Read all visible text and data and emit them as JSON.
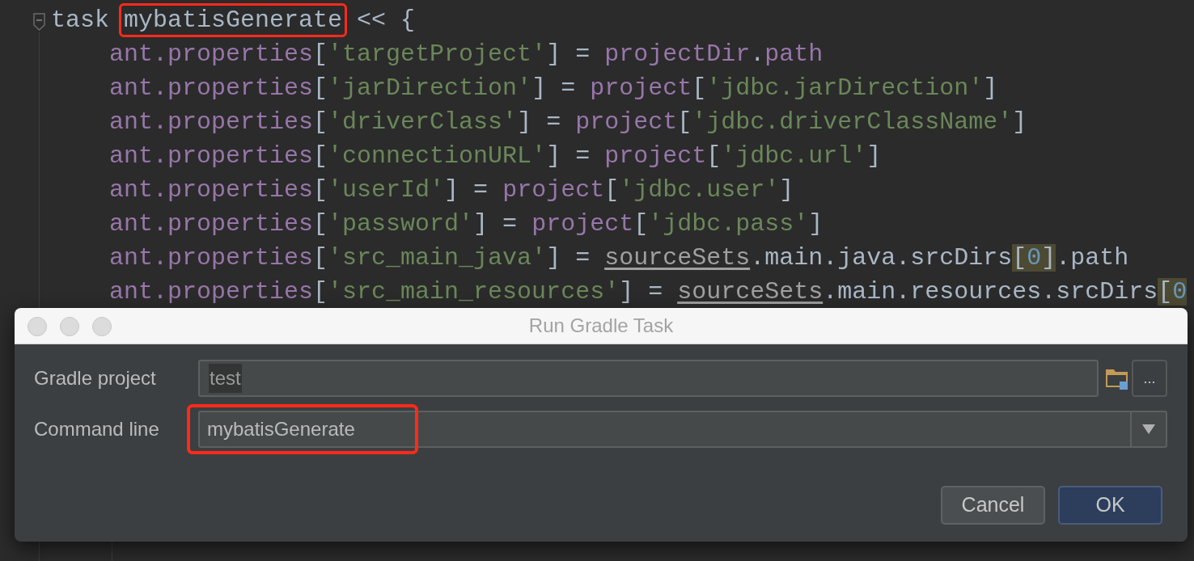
{
  "editor": {
    "lines": [
      {
        "tokens": [
          {
            "text": "task ",
            "kind": "plain"
          },
          {
            "text": "mybatisGenerate",
            "kind": "plain",
            "boxed": true
          },
          {
            "text": " << {",
            "kind": "plain"
          }
        ]
      },
      {
        "tokens": [
          {
            "text": "    ant.properties",
            "kind": "property"
          },
          {
            "text": "[",
            "kind": "plain"
          },
          {
            "text": "'targetProject'",
            "kind": "string"
          },
          {
            "text": "] = ",
            "kind": "plain"
          },
          {
            "text": "projectDir",
            "kind": "property"
          },
          {
            "text": ".",
            "kind": "plain"
          },
          {
            "text": "path",
            "kind": "property"
          }
        ]
      },
      {
        "tokens": [
          {
            "text": "    ant.properties",
            "kind": "property"
          },
          {
            "text": "[",
            "kind": "plain"
          },
          {
            "text": "'jarDirection'",
            "kind": "string"
          },
          {
            "text": "] = ",
            "kind": "plain"
          },
          {
            "text": "project",
            "kind": "property"
          },
          {
            "text": "[",
            "kind": "plain"
          },
          {
            "text": "'jdbc.jarDirection'",
            "kind": "string"
          },
          {
            "text": "]",
            "kind": "plain"
          }
        ]
      },
      {
        "tokens": [
          {
            "text": "    ant.properties",
            "kind": "property"
          },
          {
            "text": "[",
            "kind": "plain"
          },
          {
            "text": "'driverClass'",
            "kind": "string"
          },
          {
            "text": "] = ",
            "kind": "plain"
          },
          {
            "text": "project",
            "kind": "property"
          },
          {
            "text": "[",
            "kind": "plain"
          },
          {
            "text": "'jdbc.driverClassName'",
            "kind": "string"
          },
          {
            "text": "]",
            "kind": "plain"
          }
        ]
      },
      {
        "tokens": [
          {
            "text": "    ant.properties",
            "kind": "property"
          },
          {
            "text": "[",
            "kind": "plain"
          },
          {
            "text": "'connectionURL'",
            "kind": "string"
          },
          {
            "text": "] = ",
            "kind": "plain"
          },
          {
            "text": "project",
            "kind": "property"
          },
          {
            "text": "[",
            "kind": "plain"
          },
          {
            "text": "'jdbc.url'",
            "kind": "string"
          },
          {
            "text": "]",
            "kind": "plain"
          }
        ]
      },
      {
        "tokens": [
          {
            "text": "    ant.properties",
            "kind": "property"
          },
          {
            "text": "[",
            "kind": "plain"
          },
          {
            "text": "'userId'",
            "kind": "string"
          },
          {
            "text": "] = ",
            "kind": "plain"
          },
          {
            "text": "project",
            "kind": "property"
          },
          {
            "text": "[",
            "kind": "plain"
          },
          {
            "text": "'jdbc.user'",
            "kind": "string"
          },
          {
            "text": "]",
            "kind": "plain"
          }
        ]
      },
      {
        "tokens": [
          {
            "text": "    ant.properties",
            "kind": "property"
          },
          {
            "text": "[",
            "kind": "plain"
          },
          {
            "text": "'password'",
            "kind": "string"
          },
          {
            "text": "] = ",
            "kind": "plain"
          },
          {
            "text": "project",
            "kind": "property"
          },
          {
            "text": "[",
            "kind": "plain"
          },
          {
            "text": "'jdbc.pass'",
            "kind": "string"
          },
          {
            "text": "]",
            "kind": "plain"
          }
        ]
      },
      {
        "tokens": [
          {
            "text": "    ant.properties",
            "kind": "property"
          },
          {
            "text": "[",
            "kind": "plain"
          },
          {
            "text": "'src_main_java'",
            "kind": "string"
          },
          {
            "text": "] = ",
            "kind": "plain"
          },
          {
            "text": "sourceSets",
            "kind": "link"
          },
          {
            "text": ".main.java.srcDirs",
            "kind": "plain"
          },
          {
            "text": "[",
            "kind": "plain",
            "matched": true
          },
          {
            "text": "0",
            "kind": "number",
            "matched": true
          },
          {
            "text": "]",
            "kind": "plain",
            "matched": true
          },
          {
            "text": ".path",
            "kind": "plain"
          }
        ]
      },
      {
        "tokens": [
          {
            "text": "    ant.properties",
            "kind": "property"
          },
          {
            "text": "[",
            "kind": "plain"
          },
          {
            "text": "'src_main_resources'",
            "kind": "string"
          },
          {
            "text": "] = ",
            "kind": "plain"
          },
          {
            "text": "sourceSets",
            "kind": "link"
          },
          {
            "text": ".main.resources.srcDirs",
            "kind": "plain"
          },
          {
            "text": "[",
            "kind": "plain",
            "matched": true
          },
          {
            "text": "0",
            "kind": "number",
            "matched": true
          }
        ]
      }
    ]
  },
  "dialog": {
    "title": "Run Gradle Task",
    "fields": [
      {
        "label": "Gradle project",
        "value": "test",
        "kind": "browse",
        "boxed": false
      },
      {
        "label": "Command line",
        "value": "mybatisGenerate",
        "kind": "dropdown",
        "boxed": true
      }
    ],
    "browse_button": "...",
    "buttons": [
      {
        "label": "Cancel",
        "default": false
      },
      {
        "label": "OK",
        "default": true
      }
    ]
  }
}
